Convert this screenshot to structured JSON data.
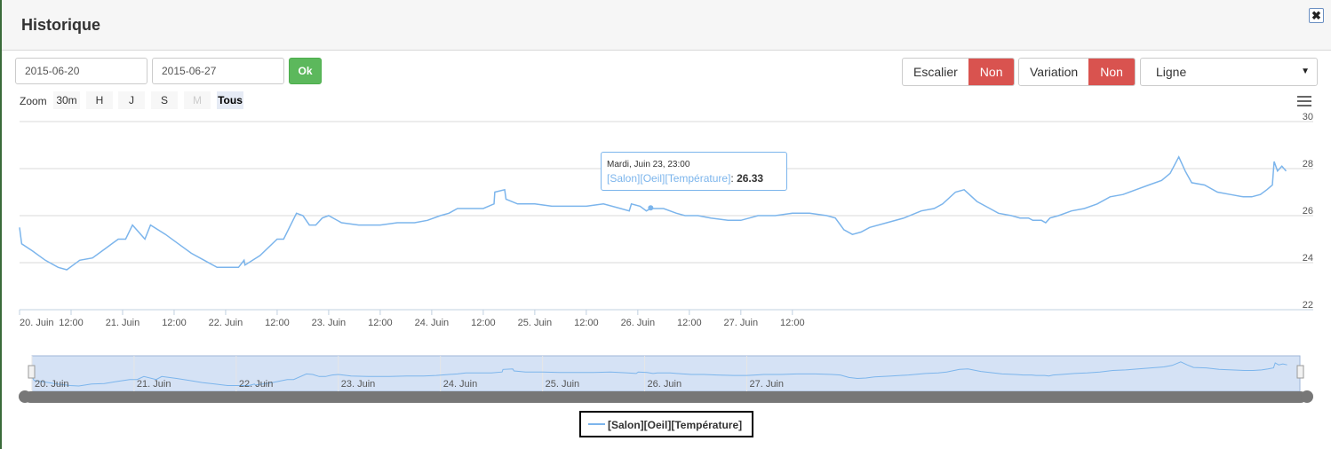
{
  "header": {
    "title": "Historique",
    "close_icon": "close-icon"
  },
  "controls": {
    "start_date": "2015-06-20",
    "end_date": "2015-06-27",
    "ok_label": "Ok",
    "escalier_label": "Escalier",
    "escalier_value": "Non",
    "variation_label": "Variation",
    "variation_value": "Non",
    "type_value": "Ligne",
    "colors": {
      "ok": "#5cb85c",
      "off": "#d9534f"
    }
  },
  "zoom": {
    "label": "Zoom",
    "buttons": [
      {
        "label": "30m",
        "state": "normal"
      },
      {
        "label": "H",
        "state": "normal"
      },
      {
        "label": "J",
        "state": "normal"
      },
      {
        "label": "S",
        "state": "normal"
      },
      {
        "label": "M",
        "state": "disabled"
      },
      {
        "label": "Tous",
        "state": "active"
      }
    ]
  },
  "tooltip": {
    "date": "Mardi, Juin 23, 23:00",
    "series": "[Salon][Oeil][Température]",
    "value": "26.33"
  },
  "chart_data": {
    "type": "line",
    "title": "",
    "xlabel": "",
    "ylabel": "",
    "ylim": [
      22,
      30
    ],
    "y_ticks": [
      "22",
      "24",
      "26",
      "28",
      "30"
    ],
    "x_ticks": [
      "20. Juin",
      "12:00",
      "21. Juin",
      "12:00",
      "22. Juin",
      "12:00",
      "23. Juin",
      "12:00",
      "24. Juin",
      "12:00",
      "25. Juin",
      "12:00",
      "26. Juin",
      "12:00",
      "27. Juin",
      "12:00"
    ],
    "navigator_ticks": [
      "20. Juin",
      "21. Juin",
      "22. Juin",
      "23. Juin",
      "24. Juin",
      "25. Juin",
      "26. Juin",
      "27. Juin"
    ],
    "grid": true,
    "legend_position": "bottom-center",
    "color": "#7cb5ec",
    "series": [
      {
        "name": "[Salon][Oeil][Température]",
        "unit": "hours",
        "points": [
          [
            0,
            25.5
          ],
          [
            0.5,
            24.8
          ],
          [
            3,
            24.5
          ],
          [
            6,
            24.1
          ],
          [
            9,
            23.8
          ],
          [
            11,
            23.7
          ],
          [
            12.5,
            23.9
          ],
          [
            14,
            24.1
          ],
          [
            17,
            24.2
          ],
          [
            20,
            24.6
          ],
          [
            23,
            25.0
          ],
          [
            24.7,
            25.0
          ],
          [
            26.3,
            25.6
          ],
          [
            29.2,
            25.0
          ],
          [
            30.5,
            25.6
          ],
          [
            34,
            25.2
          ],
          [
            37,
            24.8
          ],
          [
            40,
            24.4
          ],
          [
            43,
            24.1
          ],
          [
            46,
            23.8
          ],
          [
            48,
            23.8
          ],
          [
            51,
            23.8
          ],
          [
            52.3,
            24.1
          ],
          [
            52.5,
            23.9
          ],
          [
            56,
            24.3
          ],
          [
            60,
            25.0
          ],
          [
            61.5,
            25.0
          ],
          [
            64.5,
            26.1
          ],
          [
            66,
            26.0
          ],
          [
            67.5,
            25.6
          ],
          [
            69,
            25.6
          ],
          [
            70.5,
            25.9
          ],
          [
            72,
            26.0
          ],
          [
            75,
            25.7
          ],
          [
            79,
            25.6
          ],
          [
            84,
            25.6
          ],
          [
            88,
            25.7
          ],
          [
            92,
            25.7
          ],
          [
            95,
            25.8
          ],
          [
            98,
            26.0
          ],
          [
            100,
            26.1
          ],
          [
            102,
            26.3
          ],
          [
            105,
            26.3
          ],
          [
            108,
            26.3
          ],
          [
            110.5,
            26.5
          ],
          [
            110.7,
            27.0
          ],
          [
            113,
            27.1
          ],
          [
            113.3,
            26.7
          ],
          [
            116,
            26.5
          ],
          [
            120,
            26.5
          ],
          [
            124,
            26.4
          ],
          [
            128,
            26.4
          ],
          [
            132,
            26.4
          ],
          [
            136,
            26.5
          ],
          [
            140,
            26.3
          ],
          [
            142,
            26.2
          ],
          [
            142.5,
            26.5
          ],
          [
            144.5,
            26.4
          ],
          [
            146,
            26.2
          ],
          [
            147,
            26.3
          ],
          [
            150,
            26.3
          ],
          [
            153,
            26.1
          ],
          [
            155,
            26.0
          ],
          [
            158,
            26.0
          ],
          [
            161,
            25.9
          ],
          [
            165,
            25.8
          ],
          [
            168,
            25.8
          ],
          [
            170,
            25.9
          ],
          [
            172,
            26.0
          ],
          [
            176,
            26.0
          ],
          [
            180,
            26.1
          ],
          [
            184,
            26.1
          ],
          [
            188,
            26.0
          ],
          [
            190,
            25.9
          ],
          [
            192,
            25.4
          ],
          [
            194,
            25.2
          ],
          [
            196,
            25.3
          ],
          [
            198,
            25.5
          ],
          [
            202,
            25.7
          ],
          [
            206,
            25.9
          ],
          [
            210,
            26.2
          ],
          [
            213,
            26.3
          ],
          [
            215,
            26.5
          ],
          [
            218,
            27.0
          ],
          [
            220,
            27.1
          ],
          [
            223,
            26.6
          ],
          [
            226,
            26.3
          ],
          [
            228,
            26.1
          ],
          [
            231,
            26.0
          ],
          [
            233,
            25.9
          ],
          [
            235,
            25.9
          ],
          [
            236,
            25.8
          ],
          [
            238,
            25.8
          ],
          [
            239,
            25.7
          ],
          [
            240,
            25.9
          ],
          [
            242,
            26.0
          ],
          [
            245,
            26.2
          ],
          [
            248,
            26.3
          ],
          [
            251,
            26.5
          ],
          [
            254,
            26.8
          ],
          [
            257,
            26.9
          ],
          [
            260,
            27.1
          ],
          [
            263,
            27.3
          ],
          [
            266,
            27.5
          ],
          [
            268,
            27.8
          ],
          [
            270,
            28.5
          ],
          [
            271.5,
            27.9
          ],
          [
            273,
            27.4
          ],
          [
            276,
            27.3
          ],
          [
            279,
            27.0
          ],
          [
            282,
            26.9
          ],
          [
            285,
            26.8
          ],
          [
            287,
            26.8
          ],
          [
            289,
            26.9
          ],
          [
            290.5,
            27.1
          ],
          [
            291.8,
            27.3
          ],
          [
            292.2,
            28.3
          ],
          [
            293,
            27.9
          ],
          [
            294,
            28.1
          ],
          [
            295,
            27.9
          ]
        ]
      }
    ]
  }
}
